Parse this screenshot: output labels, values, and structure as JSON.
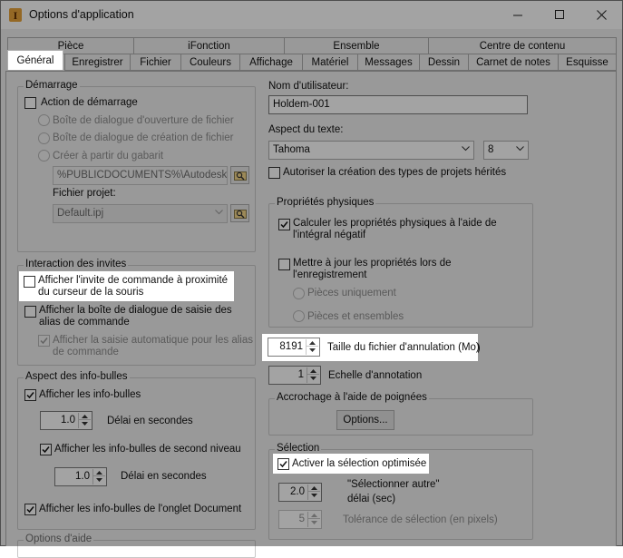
{
  "window": {
    "title": "Options d'application",
    "minimize_glyph": "—",
    "maximize_glyph": "☐",
    "close_glyph": "✕",
    "icon": "inventor-app-icon"
  },
  "tabs_row1": [
    "Pièce",
    "iFonction",
    "Ensemble",
    "Centre de contenu"
  ],
  "tabs_row2": [
    "Général",
    "Enregistrer",
    "Fichier",
    "Couleurs",
    "Affichage",
    "Matériel",
    "Messages",
    "Dessin",
    "Carnet de notes",
    "Esquisse"
  ],
  "active_tab": "Général",
  "left": {
    "startup": {
      "title": "Démarrage",
      "action_label": "Action de démarrage",
      "action_checked": false,
      "opt_open": "Boîte de dialogue d'ouverture de fichier",
      "opt_create": "Boîte de dialogue de création de fichier",
      "opt_template": "Créer à partir du gabarit",
      "template_path": "%PUBLICDOCUMENTS%\\Autodesk\\Inv",
      "project_label": "Fichier projet:",
      "project_value": "Default.ipj"
    },
    "prompts": {
      "title": "Interaction des invites",
      "cmd_prompt_label": "Afficher l'invite de commande à proximité du curseur de la souris",
      "cmd_prompt_checked": false,
      "alias_dialog_label": "Afficher la boîte de dialogue de saisie des alias de commande",
      "alias_dialog_checked": false,
      "autocomplete_label": "Afficher la saisie automatique pour les alias de commande",
      "autocomplete_checked": true
    },
    "tooltips": {
      "title": "Aspect des info-bulles",
      "show_label": "Afficher les info-bulles",
      "show_checked": true,
      "delay1_value": "1.0",
      "delay1_label": "Délai en secondes",
      "second_label": "Afficher les info-bulles de second niveau",
      "second_checked": true,
      "delay2_value": "1.0",
      "delay2_label": "Délai en secondes",
      "doc_tab_label": "Afficher les info-bulles de l'onglet Document",
      "doc_tab_checked": true
    },
    "help_title": "Options d'aide"
  },
  "right": {
    "username_label": "Nom d'utilisateur:",
    "username_value": "Holdem-001",
    "text_appearance_label": "Aspect du texte:",
    "font_value": "Tahoma",
    "size_value": "8",
    "legacy_label": "Autoriser la création des types de projets hérités",
    "legacy_checked": false,
    "physical": {
      "title": "Propriétés physiques",
      "negative_label": "Calculer les propriétés physiques à l'aide de l'intégral négatif",
      "negative_checked": true,
      "update_label": "Mettre à jour les propriétés lors de l'enregistrement",
      "update_checked": false,
      "parts_only": "Pièces uniquement",
      "parts_assemblies": "Pièces et ensembles"
    },
    "undo_value": "8191",
    "undo_label": "Taille du fichier d'annulation (Mo)",
    "annotation_value": "1",
    "annotation_label": "Echelle d'annotation",
    "grips": {
      "title": "Accrochage à l'aide de poignées",
      "options_button": "Options..."
    },
    "selection": {
      "title": "Sélection",
      "optimized_label": "Activer la sélection optimisée",
      "optimized_checked": true,
      "select_other_value": "2.0",
      "select_other_label_1": "\"Sélectionner autre\"",
      "select_other_label_2": "délai (sec)",
      "tolerance_value": "5",
      "tolerance_label": "Tolérance de sélection (en pixels)"
    }
  }
}
